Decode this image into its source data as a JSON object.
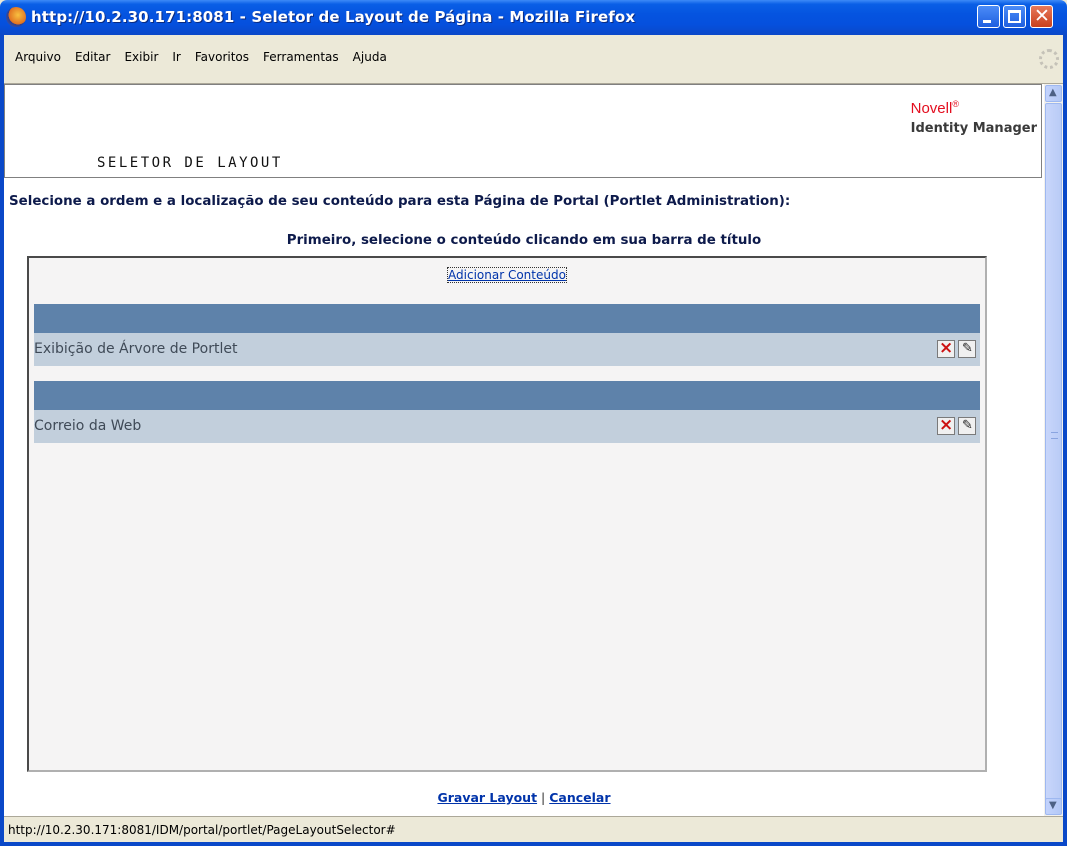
{
  "window": {
    "title": "http://10.2.30.171:8081 - Seletor de Layout de Página - Mozilla Firefox"
  },
  "menu": {
    "items": [
      "Arquivo",
      "Editar",
      "Exibir",
      "Ir",
      "Favoritos",
      "Ferramentas",
      "Ajuda"
    ]
  },
  "header": {
    "brand_name": "Novell",
    "brand_mark": "®",
    "product": "Identity Manager",
    "page_title": "SELETOR DE LAYOUT"
  },
  "instruction": "Selecione a ordem e a localização de seu conteúdo para esta Página de Portal (Portlet Administration):",
  "subinstruction": "Primeiro, selecione o conteúdo clicando em sua barra de título",
  "layout": {
    "add_content_label": "Adicionar Conteúdo",
    "portlets": [
      {
        "label": "Exibição de Árvore de Portlet",
        "remove_icon": "remove-icon",
        "edit_icon": "edit-icon"
      },
      {
        "label": "Correio da Web",
        "remove_icon": "remove-icon",
        "edit_icon": "edit-icon"
      }
    ]
  },
  "footer": {
    "save_label": "Gravar Layout",
    "separator": "|",
    "cancel_label": "Cancelar"
  },
  "statusbar": {
    "text": "http://10.2.30.171:8081/IDM/portal/portlet/PageLayoutSelector#"
  },
  "colors": {
    "titlebar": "#0554e0",
    "portlet_bar": "#5e82aa",
    "portlet_row": "#c2cfdc",
    "brand_red": "#e30d1e",
    "link_blue": "#0033aa"
  }
}
